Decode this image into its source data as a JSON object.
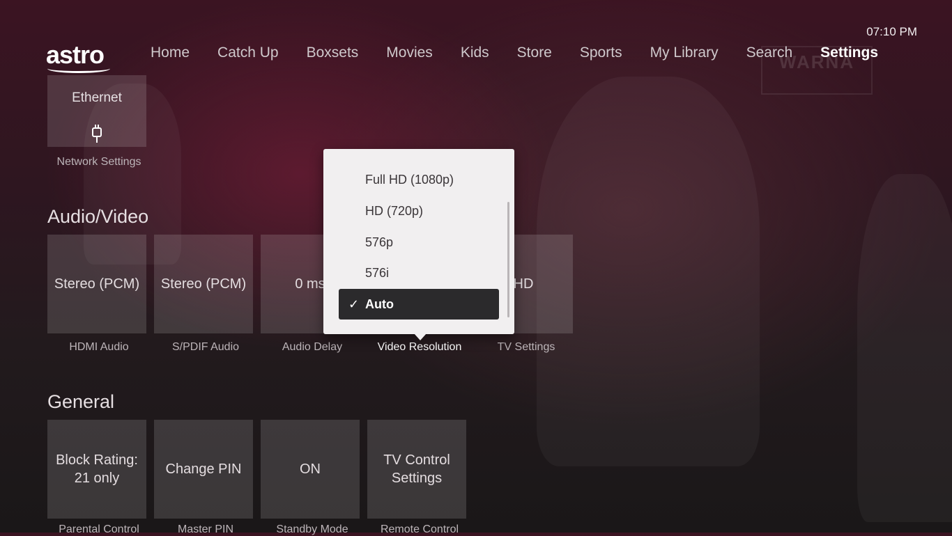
{
  "clock": "07:10 PM",
  "brand": "astro",
  "nav": [
    "Home",
    "Catch Up",
    "Boxsets",
    "Movies",
    "Kids",
    "Store",
    "Sports",
    "My Library",
    "Search",
    "Settings"
  ],
  "background_sign": "WARNA",
  "network": {
    "tile": "Ethernet",
    "label": "Network Settings"
  },
  "audio_video": {
    "title": "Audio/Video",
    "tiles": [
      {
        "value": "Stereo (PCM)",
        "label": "HDMI Audio"
      },
      {
        "value": "Stereo (PCM)",
        "label": "S/PDIF Audio"
      },
      {
        "value": "0 ms",
        "label": "Audio Delay"
      },
      {
        "value": "",
        "label": "Video Resolution"
      },
      {
        "value": "HD",
        "label": "TV Settings"
      }
    ]
  },
  "general": {
    "title": "General",
    "tiles": [
      {
        "value": "Block Rating: 21 only",
        "label": "Parental Control"
      },
      {
        "value": "Change PIN",
        "label": "Master PIN"
      },
      {
        "value": "ON",
        "label": "Standby Mode"
      },
      {
        "value": "TV Control Settings",
        "label": "Remote Control"
      }
    ]
  },
  "resolution_menu": {
    "options": [
      "Full HD (1080p)",
      "HD (720p)",
      "576p",
      "576i",
      "Auto"
    ],
    "selected": "Auto",
    "check": "✓"
  },
  "colors": {
    "accent_bg": "#3b1422",
    "menu_bg": "#f1eff0",
    "selected_bg": "#2b2a2c"
  }
}
